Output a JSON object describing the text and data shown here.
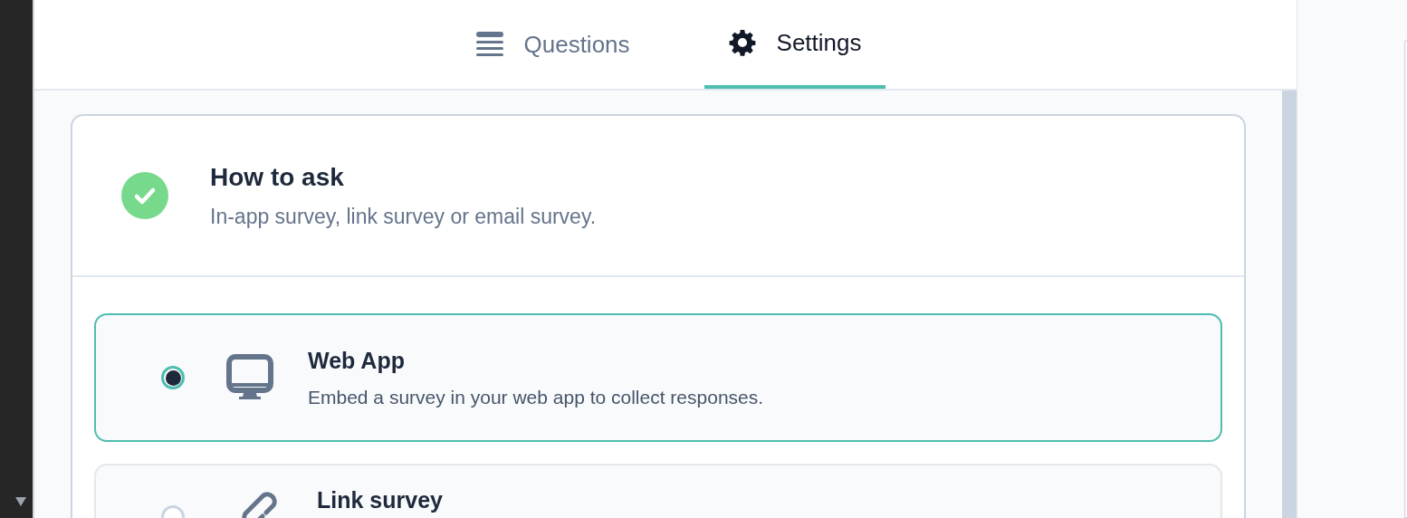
{
  "tabs": [
    {
      "label": "Questions",
      "kind": "list",
      "selected": false
    },
    {
      "label": "Settings",
      "kind": "gear",
      "selected": true
    }
  ],
  "section": {
    "title": "How to ask",
    "subtitle": "In-app survey, link survey or email survey.",
    "completed": true
  },
  "options": [
    {
      "kind": "monitor",
      "title": "Web App",
      "description": "Embed a survey in your web app to collect responses.",
      "selected": true
    },
    {
      "kind": "link",
      "title": "Link survey",
      "selected": false
    }
  ]
}
